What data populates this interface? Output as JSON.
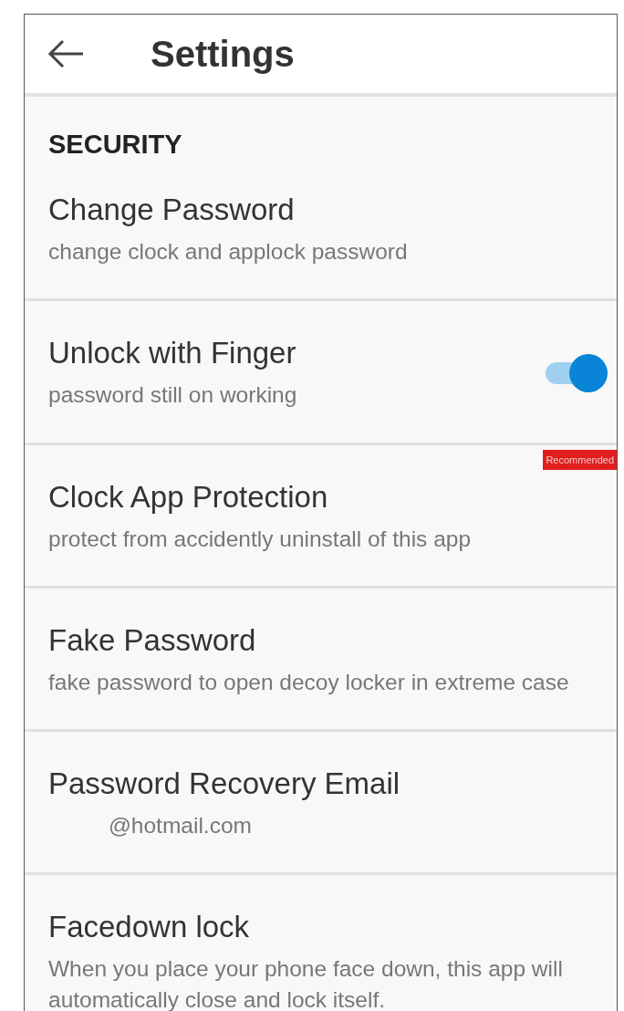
{
  "header": {
    "title": "Settings"
  },
  "section": "SECURITY",
  "items": [
    {
      "kind": "plain",
      "title": "Change Password",
      "subtitle": "change clock and applock password"
    },
    {
      "kind": "toggle",
      "title": "Unlock with Finger",
      "subtitle": "password still on working",
      "on": true
    },
    {
      "kind": "plain",
      "title": "Clock App Protection",
      "subtitle": "protect from accidently uninstall of this app",
      "badge": "Recommended"
    },
    {
      "kind": "plain",
      "title": "Fake Password",
      "subtitle": "fake password to open decoy locker in extreme case"
    },
    {
      "kind": "email",
      "title": "Password Recovery Email",
      "subtitle": "@hotmail.com"
    },
    {
      "kind": "plain",
      "title": "Facedown lock",
      "subtitle": "When you place your phone face down, this app will automatically close and lock itself."
    }
  ]
}
